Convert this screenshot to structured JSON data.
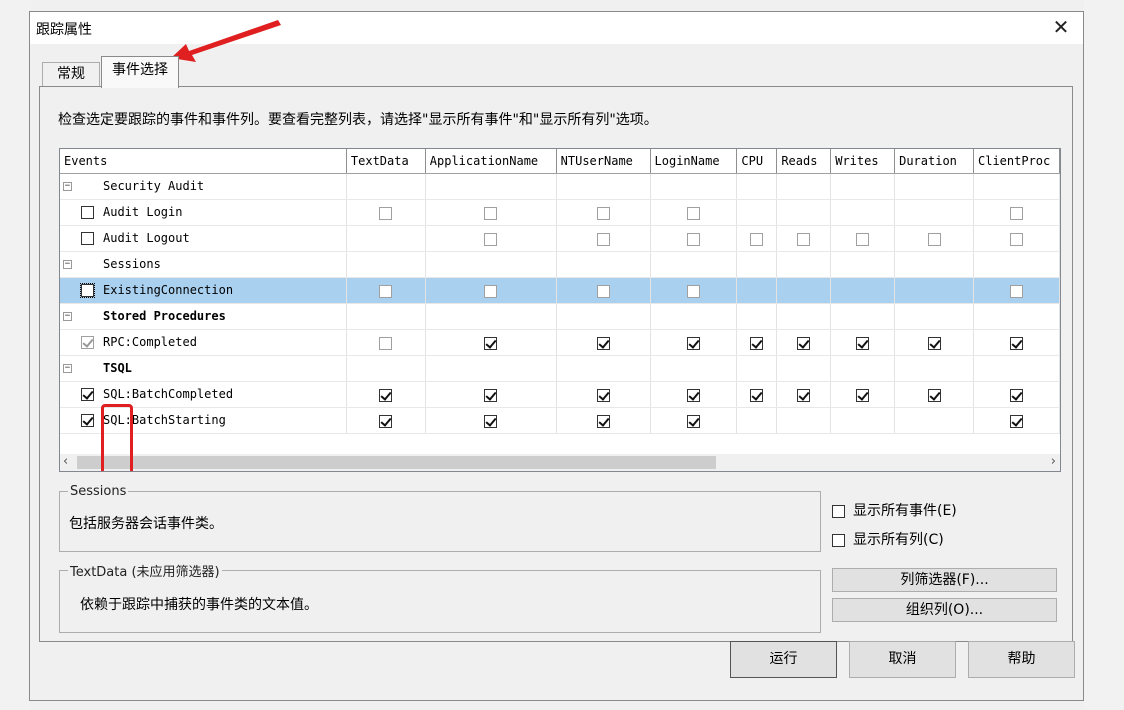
{
  "window": {
    "title": "跟踪属性"
  },
  "tabs": [
    {
      "label": "常规"
    },
    {
      "label": "事件选择"
    }
  ],
  "hint": "检查选定要跟踪的事件和事件列。要查看完整列表，请选择\"显示所有事件\"和\"显示所有列\"选项。",
  "grid": {
    "columns": [
      "Events",
      "TextData",
      "ApplicationName",
      "NTUserName",
      "LoginName",
      "CPU",
      "Reads",
      "Writes",
      "Duration",
      "ClientProc"
    ],
    "rows": [
      {
        "type": "category",
        "label": "Security Audit",
        "bold": false
      },
      {
        "type": "event",
        "label": "Audit Login",
        "cells": [
          "off",
          "off",
          "off",
          "off",
          null,
          null,
          null,
          null,
          "off"
        ]
      },
      {
        "type": "event",
        "label": "Audit Logout",
        "cells": [
          null,
          "off",
          "off",
          "off",
          "off",
          "off",
          "off",
          "off",
          "off"
        ]
      },
      {
        "type": "category",
        "label": "Sessions",
        "bold": false
      },
      {
        "type": "event",
        "label": "ExistingConnection",
        "selected": true,
        "cells": [
          "off",
          "off",
          "off",
          "off",
          null,
          null,
          null,
          null,
          "off"
        ]
      },
      {
        "type": "category",
        "label": "Stored Procedures",
        "bold": true
      },
      {
        "type": "event",
        "label": "RPC:Completed",
        "disabledCheck": true,
        "checked": true,
        "cells": [
          "off",
          "on",
          "on",
          "on",
          "on",
          "on",
          "on",
          "on",
          "on"
        ]
      },
      {
        "type": "category",
        "label": "TSQL",
        "bold": true
      },
      {
        "type": "event",
        "label": "SQL:BatchCompleted",
        "checked": true,
        "cells": [
          "on",
          "on",
          "on",
          "on",
          "on",
          "on",
          "on",
          "on",
          "on"
        ]
      },
      {
        "type": "event",
        "label": "SQL:BatchStarting",
        "checked": true,
        "cells": [
          "on",
          "on",
          "on",
          "on",
          null,
          null,
          null,
          null,
          "on"
        ]
      }
    ]
  },
  "sessions_box": {
    "legend": "Sessions",
    "text": "包括服务器会话事件类。"
  },
  "textdata_box": {
    "legend": "TextData (未应用筛选器)",
    "text": "依赖于跟踪中捕获的事件类的文本值。"
  },
  "options": {
    "show_all_events": "显示所有事件(E)",
    "show_all_columns": "显示所有列(C)"
  },
  "buttons": {
    "column_filter": "列筛选器(F)...",
    "organize": "组织列(O)...",
    "run": "运行",
    "cancel": "取消",
    "help": "帮助"
  },
  "colors": {
    "selection": "#aad0f0",
    "annotation": "#e02020"
  }
}
